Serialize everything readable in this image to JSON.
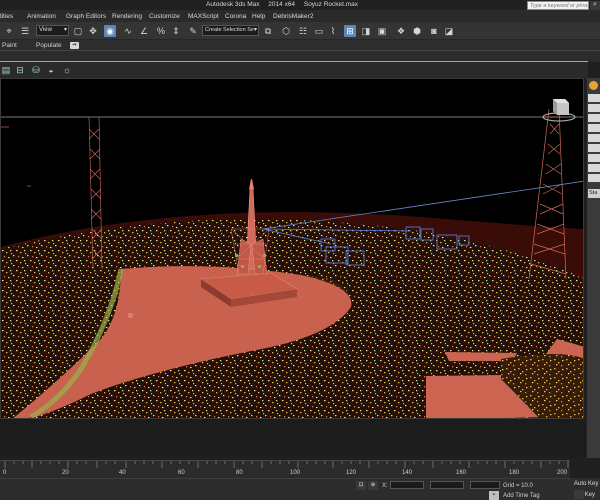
{
  "app": {
    "name": "Autodesk 3ds Max",
    "version": "2014 x64",
    "file": "Soyuz Rocket.max"
  },
  "search": {
    "placeholder": "Type a keyword or phrase"
  },
  "menu": [
    "dities",
    "Animation",
    "Graph Editors",
    "Rendering",
    "Customize",
    "MAXScript",
    "Corona",
    "Help",
    "DebrisMaker2"
  ],
  "toolbar": {
    "selection_filter": "View",
    "named_selection": "Create Selection Se"
  },
  "ribbon": {
    "tabs": [
      "Paint",
      "Populate"
    ]
  },
  "timeline": {
    "ticks": [
      "0",
      "20",
      "40",
      "60",
      "80",
      "100",
      "120",
      "140",
      "160",
      "180",
      "200"
    ]
  },
  "status": {
    "x_label": "X:",
    "grid_label": "Grid = 10.0",
    "add_time_tag": "Add Time Tag",
    "auto_key": "Auto Key",
    "set_key": "Set Key"
  },
  "command_panel": {
    "tab": "Sta"
  }
}
